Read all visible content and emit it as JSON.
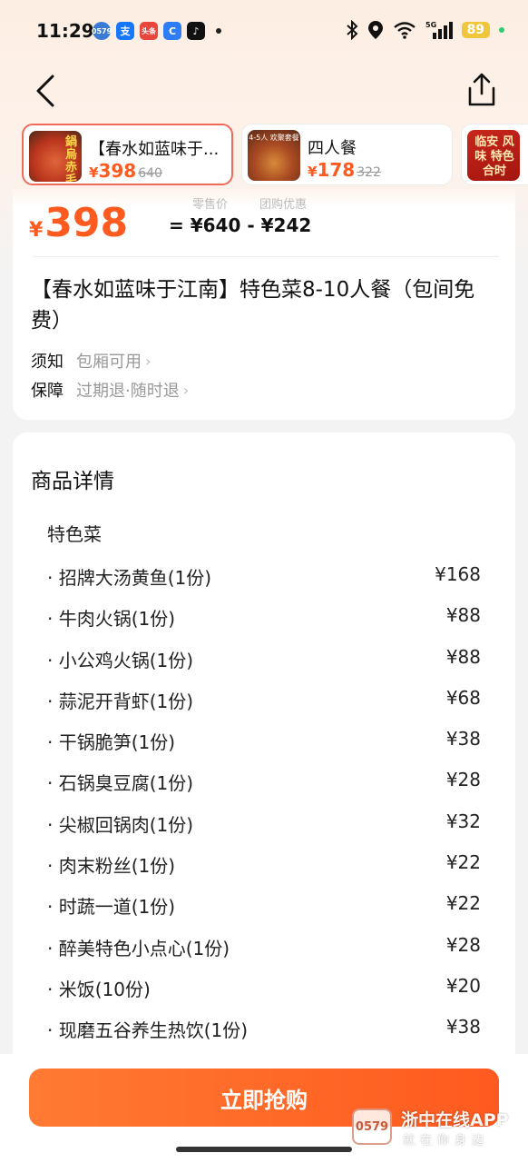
{
  "status_bar": {
    "time": "11:29",
    "apps": [
      {
        "name": "0579-app-icon",
        "glyph": "0579",
        "color": "#3a7bd5"
      },
      {
        "name": "alipay-icon",
        "glyph": "支",
        "color": "#1677ff"
      },
      {
        "name": "toutiao-icon",
        "glyph": "头条",
        "color": "#e8453c"
      },
      {
        "name": "browser-app-icon",
        "glyph": "C",
        "color": "#2f7df6"
      },
      {
        "name": "tiktok-icon",
        "glyph": "♪",
        "color": "#111111"
      }
    ],
    "network": "5G",
    "battery": "89"
  },
  "deals": [
    {
      "title": "【春水如蓝味于...",
      "currency": "¥",
      "price": "398",
      "original": "640",
      "active": true,
      "thumb_text": "鍋 烏 赤毛 烟火"
    },
    {
      "title": "四人餐",
      "currency": "¥",
      "price": "178",
      "original": "322",
      "active": false,
      "thumb_text": "4-5人 欢聚套餐"
    },
    {
      "title": "",
      "currency": "",
      "price": "",
      "original": "",
      "active": false,
      "thumb_text": "临安 风味 特色合时"
    }
  ],
  "price_block": {
    "currency": "¥",
    "price": "398",
    "original_label": "零售价",
    "discount_label": "团购优惠",
    "formula": "= ¥640 - ¥242"
  },
  "deal_title": "【春水如蓝味于江南】特色菜8-10人餐（包间免费）",
  "info_rows": [
    {
      "key": "须知",
      "value": "包厢可用"
    },
    {
      "key": "保障",
      "value": "过期退·随时退"
    }
  ],
  "details": {
    "section_title": "商品详情",
    "group_title": "特色菜",
    "items": [
      {
        "name": "· 招牌大汤黄鱼(1份)",
        "price": "¥168"
      },
      {
        "name": "· 牛肉火锅(1份)",
        "price": "¥88"
      },
      {
        "name": "· 小公鸡火锅(1份)",
        "price": "¥88"
      },
      {
        "name": "· 蒜泥开背虾(1份)",
        "price": "¥68"
      },
      {
        "name": "· 干锅脆笋(1份)",
        "price": "¥38"
      },
      {
        "name": "· 石锅臭豆腐(1份)",
        "price": "¥28"
      },
      {
        "name": "· 尖椒回锅肉(1份)",
        "price": "¥32"
      },
      {
        "name": "· 肉末粉丝(1份)",
        "price": "¥22"
      },
      {
        "name": "· 时蔬一道(1份)",
        "price": "¥22"
      },
      {
        "name": "· 醉美特色小点心(1份)",
        "price": "¥28"
      },
      {
        "name": "· 米饭(10份)",
        "price": "¥20"
      },
      {
        "name": "· 现磨五谷养生热饮(1份)",
        "price": "¥38"
      }
    ]
  },
  "buy_button": "立即抢购",
  "watermark": {
    "logo": "0579",
    "name": "浙中在线APP",
    "tagline": "就在你身边"
  },
  "colors": {
    "accent": "#ff5a1f",
    "active_border": "#f06a5a"
  }
}
